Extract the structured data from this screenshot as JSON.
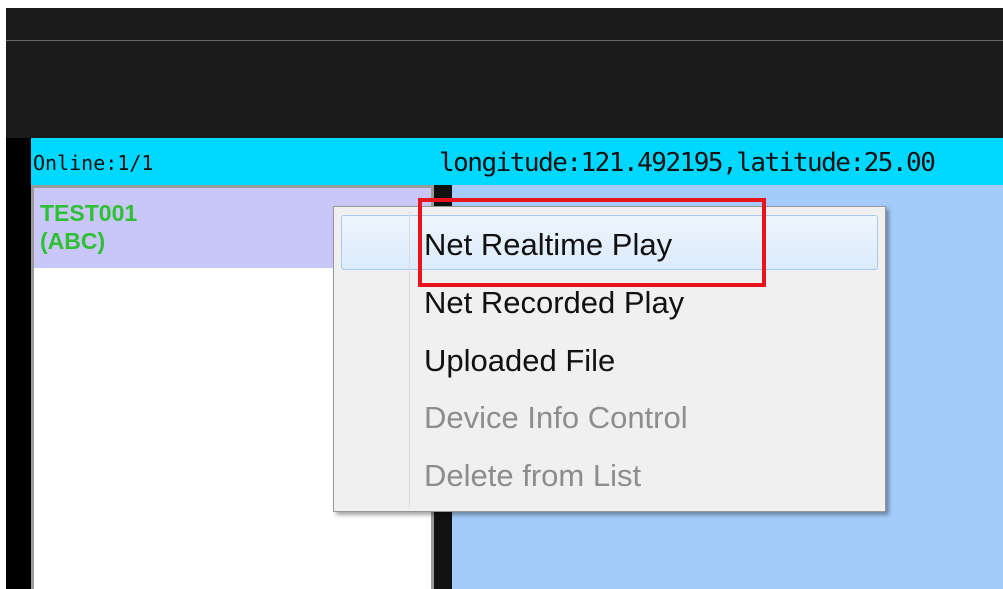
{
  "status_bar": {
    "online": "Online:1/1",
    "coordinates": "longitude:121.492195,latitude:25.00"
  },
  "device_list": {
    "items": [
      {
        "name": "TEST001",
        "alias": "(ABC)"
      }
    ]
  },
  "context_menu": {
    "items": [
      {
        "label": "Net Realtime Play",
        "enabled": true,
        "hovered": true
      },
      {
        "label": "Net Recorded Play",
        "enabled": true
      },
      {
        "label": "Uploaded File",
        "enabled": true
      },
      {
        "label": "Device Info Control",
        "enabled": false
      },
      {
        "label": "Delete from List",
        "enabled": false
      }
    ]
  },
  "colors": {
    "status_bar": "#00d8ff",
    "device_text": "#2fbf35",
    "device_selected_bg": "#c8c7f7",
    "map_bg": "#a4ccfb",
    "highlight_box": "#e8141c"
  }
}
